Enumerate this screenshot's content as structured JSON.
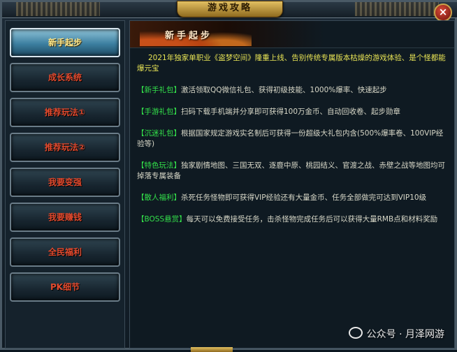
{
  "window": {
    "title": "游戏攻略",
    "close_symbol": "×"
  },
  "sidebar": {
    "items": [
      {
        "label": "新手起步",
        "active": true
      },
      {
        "label": "成长系统",
        "active": false
      },
      {
        "label": "推荐玩法①",
        "active": false
      },
      {
        "label": "推荐玩法②",
        "active": false
      },
      {
        "label": "我要变强",
        "active": false
      },
      {
        "label": "我要赚钱",
        "active": false
      },
      {
        "label": "全民福利",
        "active": false
      },
      {
        "label": "PK细节",
        "active": false
      }
    ]
  },
  "content": {
    "title": "新手起步",
    "intro": "2021年独家单职业《盗梦空间》隆重上线、告别传统专属版本枯燥的游戏体验、是个怪都能爆元宝",
    "paragraphs": [
      {
        "tag": "【新手礼包】",
        "text": "激活领取QQ微信礼包、获得初级技能、1000%爆率、快速起步"
      },
      {
        "tag": "【手游礼包】",
        "text": "扫码下载手机端并分享即可获得100万金币、自动回收卷、起步勋章"
      },
      {
        "tag": "【沉迷礼包】",
        "text": "根据国家规定游戏实名制后可获得一份超级大礼包内含(500%爆率卷、100VIP经验等)"
      },
      {
        "tag": "【特色玩法】",
        "text": "独家剧情地图、三国无双、逐鹿中原、桃园结义、官渡之战、赤壁之战等地图均可掉落专属装备"
      },
      {
        "tag": "【散人福利】",
        "text": "杀死任务怪物即可获得VIP经验还有大量金币、任务全部做完可达到VIP10级"
      },
      {
        "tag": "【BOSS悬赏】",
        "text": "每天可以免费接受任务，击杀怪物完成任务后可以获得大量RMB点和材料奖励"
      }
    ]
  },
  "watermark": {
    "text": "公众号 · 月泽网游",
    "icon": "wechat-icon"
  },
  "colors": {
    "tag": "#33e04a",
    "intro": "#e8e455",
    "nav_text": "#e24a2e",
    "active_text": "#ffe88a"
  }
}
